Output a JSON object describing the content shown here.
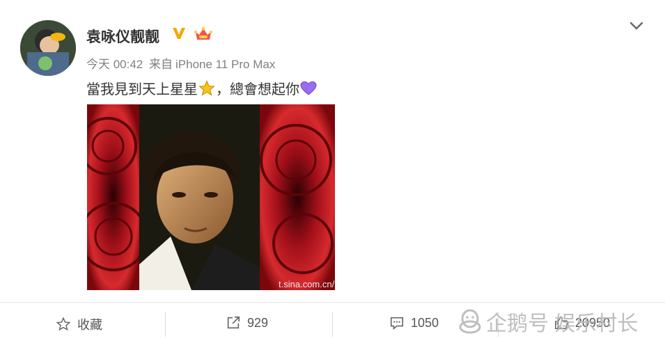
{
  "post": {
    "username": "袁咏仪靓靓",
    "time": "今天 00:42",
    "source_prefix": "来自",
    "source_device": "iPhone 11 Pro Max",
    "text_part1": "當我見到天上星星",
    "text_part2": "，總會想起你",
    "image_watermark": "t.sina.com.cn/袁",
    "icons": [
      "verified-v-icon",
      "crown-badge-icon",
      "star-emoji-icon",
      "purple-heart-emoji-icon",
      "chevron-down-icon"
    ]
  },
  "actions": {
    "favorite_label": "收藏",
    "repost_count": "929",
    "comment_count": "1050",
    "like_count": "20950"
  },
  "overlay": {
    "text": "企鹅号 娱乐村长"
  },
  "colors": {
    "verified": "#f7a800",
    "heart": "#9b6cf0",
    "star": "#f5c518"
  }
}
